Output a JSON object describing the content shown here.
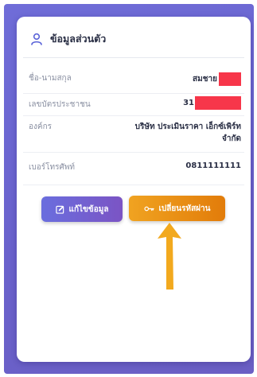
{
  "card": {
    "title": "ข้อมูลส่วนตัว"
  },
  "fields": {
    "name": {
      "label": "ชื่อ-นามสกุล",
      "value": "สมชาย"
    },
    "id_card": {
      "label": "เลขบัตรประชาชน",
      "value": "31"
    },
    "organization": {
      "label": "องค์กร",
      "value": "บริษัท ประเมินราคา เอ็กซ์เพิร์ท จำกัด"
    },
    "phone": {
      "label": "เบอร์โทรศัพท์",
      "value": "0811111111"
    }
  },
  "actions": {
    "edit_label": "แก้ไขข้อมูล",
    "change_password_label": "เปลี่ยนรหัสผ่าน"
  },
  "icons": {
    "header": "user-icon",
    "edit": "edit-icon",
    "password": "key-icon",
    "annotation": "arrow-up-icon"
  },
  "colors": {
    "background": "#6b66cf",
    "edit_button": "#6f63d4",
    "password_button": "#ea900f",
    "redaction": "#f7364a",
    "arrow": "#f2a91e"
  }
}
